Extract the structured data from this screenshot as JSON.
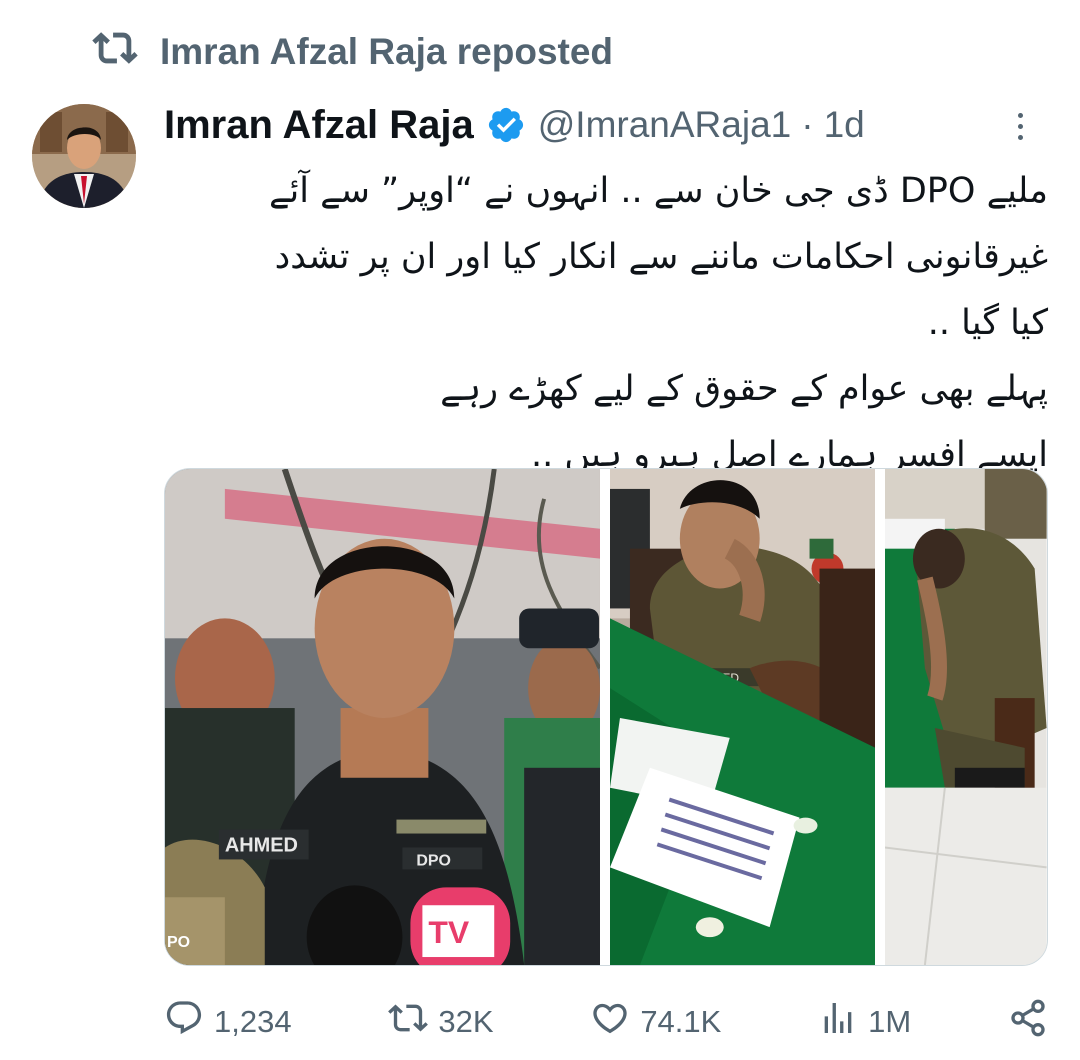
{
  "repost": {
    "label": "Imran Afzal Raja reposted"
  },
  "author": {
    "name": "Imran Afzal Raja",
    "handle": "@ImranARaja1",
    "separator": "·",
    "time": "1d"
  },
  "tweet": {
    "lines": [
      "ملیے DPO ڈی جی خان سے .. انہوں نے “اوپر” سے آئے",
      "غیرقانونی احکامات ماننے سے انکار کیا اور ان پر تشدد",
      "کیا گیا ..",
      "پہلے بھی عوام کے حقوق کے لیے کھڑے رہے",
      "ایسے افسر ہمارے اصل ہیرو ہیں .."
    ]
  },
  "media": {
    "left": {
      "badge_text": "AHMED",
      "rank_text": "DPO",
      "mic_logo": "TV",
      "side_text": "PO"
    },
    "middle": {
      "name_plate": "AHMED"
    }
  },
  "actions": {
    "replies": "1,234",
    "reposts": "32K",
    "likes": "74.1K",
    "views": "1M"
  },
  "icons": {
    "repost": "repost-icon",
    "verified": "verified-badge-icon",
    "more": "more-icon",
    "reply": "reply-icon",
    "like": "heart-icon",
    "views": "views-icon",
    "share": "share-icon"
  },
  "colors": {
    "verified": "#1d9bf0",
    "muted": "#536471",
    "text": "#0f1419"
  }
}
